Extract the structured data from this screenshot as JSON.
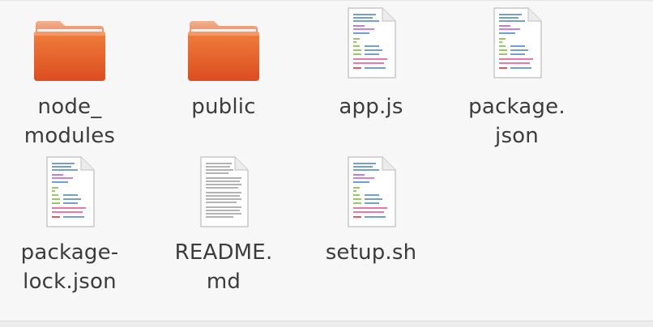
{
  "files": [
    {
      "name": "node_\nmodules",
      "type": "folder",
      "icon": "folder-icon",
      "accent": "#e2602b"
    },
    {
      "name": "public",
      "type": "folder",
      "icon": "folder-icon",
      "accent": "#e2602b"
    },
    {
      "name": "app.js",
      "type": "code",
      "icon": "code-file-icon"
    },
    {
      "name": "package.\njson",
      "type": "code",
      "icon": "code-file-icon"
    },
    {
      "name": "package-\nlock.json",
      "type": "code",
      "icon": "code-file-icon"
    },
    {
      "name": "README.\nmd",
      "type": "text",
      "icon": "text-file-icon"
    },
    {
      "name": "setup.sh",
      "type": "code",
      "icon": "code-file-icon"
    }
  ],
  "colors": {
    "background": "#f7f7f7",
    "label": "#3c3c3c",
    "folder_front": "#e8652d",
    "folder_back": "#f0a070"
  }
}
